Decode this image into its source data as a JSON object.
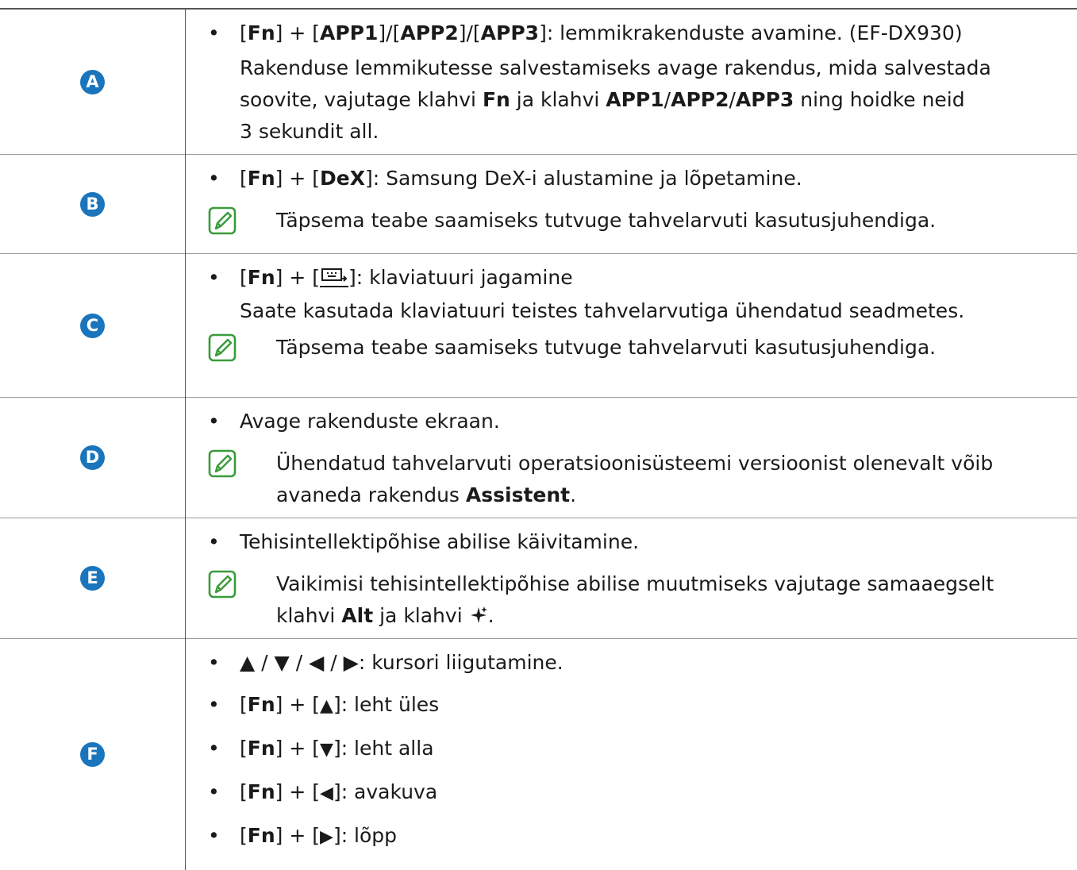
{
  "rows": [
    {
      "badge": "A",
      "bullets": [
        {
          "parts": [
            "[",
            "Fn",
            "] + [",
            "APP1",
            "]/[",
            "APP2",
            "]/[",
            "APP3",
            "]: lemmikrakenduste avamine. (EF-DX930)"
          ],
          "bold_idx": [
            1,
            3,
            5,
            7
          ]
        }
      ],
      "para_lines": [
        "Rakenduse lemmikutesse salvestamiseks avage rakendus, mida salvestada",
        "soovite, vajutage klahvi Fn ja klahvi APP1/APP2/APP3 ning hoidke neid",
        "3 sekundit all."
      ]
    },
    {
      "badge": "B",
      "bullet": "[Fn] + [DeX]: Samsung DeX-i alustamine ja lõpetamine.",
      "note": "Täpsema teabe saamiseks tutvuge tahvelarvuti kasutusjuhendiga."
    },
    {
      "badge": "C",
      "bullet_prefix": "[",
      "bullet_fn": "Fn",
      "bullet_mid": "] + [",
      "bullet_suffix": "]: klaviatuuri jagamine",
      "para": "Saate kasutada klaviatuuri teistes tahvelarvutiga ühendatud seadmetes.",
      "note": "Täpsema teabe saamiseks tutvuge tahvelarvuti kasutusjuhendiga."
    },
    {
      "badge": "D",
      "bullet": "Avage rakenduste ekraan.",
      "note_line1": "Ühendatud tahvelarvuti operatsioonisüsteemi versioonist olenevalt võib",
      "note_line2_pre": "avaneda rakendus ",
      "note_line2_bold": "Assistent",
      "note_line2_post": "."
    },
    {
      "badge": "E",
      "bullet": "Tehisintellektipõhise abilise käivitamine.",
      "note_line1": "Vaikimisi tehisintellektipõhise abilise muutmiseks vajutage samaaegselt",
      "note_line2_pre": "klahvi ",
      "note_line2_bold": "Alt",
      "note_line2_mid": " ja klahvi ",
      "note_line2_post": "."
    },
    {
      "badge": "F",
      "bullet1": "▲ / ▼ / ◀ / ▶: kursori liigutamine.",
      "bullet2_arrow": "▲",
      "bullet2_text": "]: leht üles",
      "bullet3_arrow": "▼",
      "bullet3_text": "]: leht alla",
      "bullet4_arrow": "◀",
      "bullet4_text": "]: avakuva",
      "bullet5_arrow": "▶",
      "bullet5_text": "]: lõpp",
      "fn": "Fn"
    }
  ],
  "colors": {
    "badge": "#1b75bc",
    "note_icon": "#3a9b3a"
  }
}
